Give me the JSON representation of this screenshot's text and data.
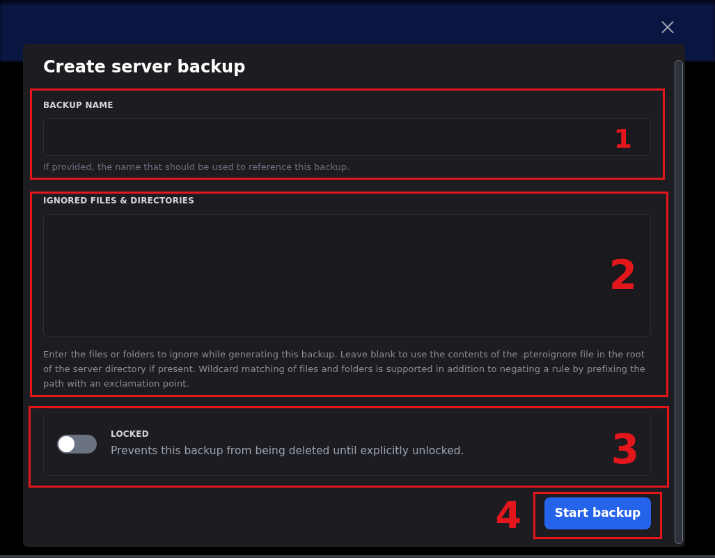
{
  "dialog": {
    "title": "Create server backup",
    "fields": [
      {
        "kind": "text",
        "label": "BACKUP NAME",
        "helper": "If provided, the name that should be used to reference this backup.",
        "annotation": "1"
      },
      {
        "kind": "textarea",
        "label": "IGNORED FILES & DIRECTORIES",
        "helper": "Enter the files or folders to ignore while generating this backup. Leave blank to use the contents of the .pteroignore file in the root of the server directory if present. Wildcard matching of files and folders is supported in addition to negating a rule by prefixing the path with an exclamation point.",
        "annotation": "2"
      }
    ],
    "lock_option": {
      "label": "LOCKED",
      "description": "Prevents this backup from being deleted until explicitly unlocked.",
      "on": false,
      "annotation": "3"
    },
    "submit": {
      "label": "Start backup",
      "annotation": "4"
    }
  }
}
